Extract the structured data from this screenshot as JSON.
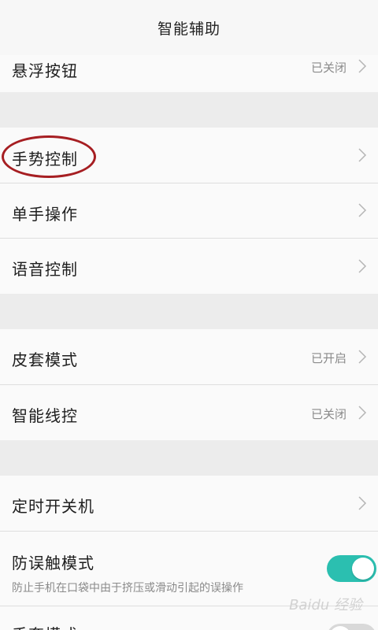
{
  "header": {
    "title": "智能辅助"
  },
  "rows": {
    "float_button": {
      "label": "悬浮按钮",
      "status": "已关闭"
    },
    "gesture_control": {
      "label": "手势控制"
    },
    "one_hand": {
      "label": "单手操作"
    },
    "voice_control": {
      "label": "语音控制"
    },
    "cover_mode": {
      "label": "皮套模式",
      "status": "已开启"
    },
    "smart_wire": {
      "label": "智能线控",
      "status": "已关闭"
    },
    "scheduled_power": {
      "label": "定时开关机"
    },
    "anti_touch": {
      "label": "防误触模式",
      "description": "防止手机在口袋中由于挤压或滑动引起的误操作",
      "enabled": true
    },
    "glove_mode": {
      "label": "手套模式",
      "enabled": false
    }
  },
  "watermark": "Baidu 经验",
  "colors": {
    "toggle_on": "#2bbfb0",
    "highlight_circle": "#a61e22"
  }
}
